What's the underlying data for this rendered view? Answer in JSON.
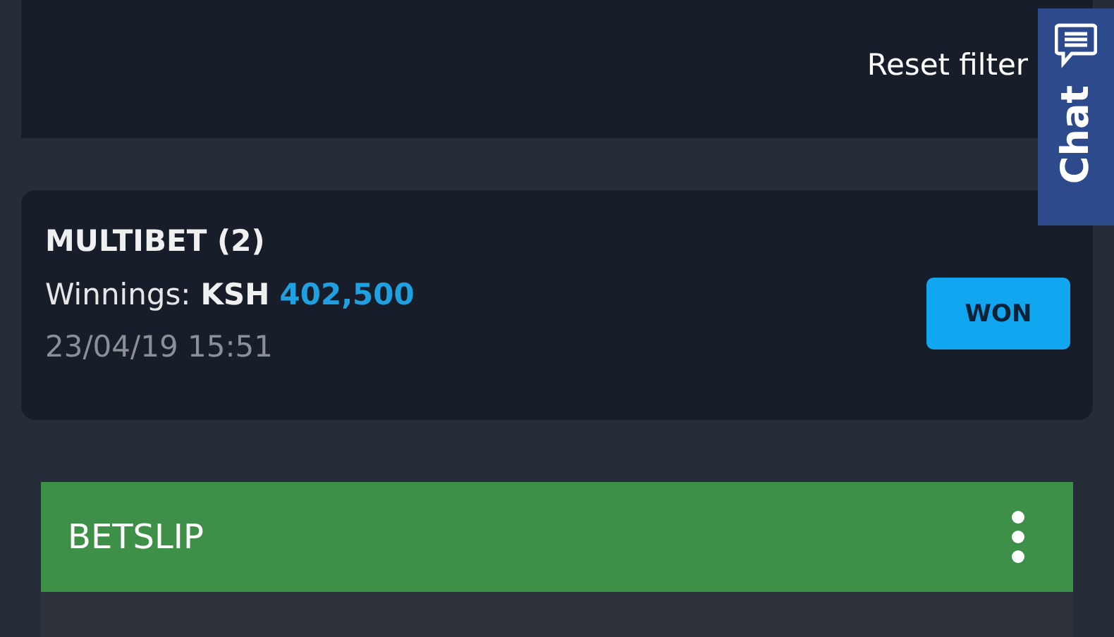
{
  "filters": {
    "reset_link": "Reset filter"
  },
  "chat_tab": {
    "label": "Chat"
  },
  "bet": {
    "title": "MULTIBET (2)",
    "winnings_label": "Winnings:",
    "currency": "KSH",
    "amount": "402,500",
    "date": "23/04/19 15:51",
    "status": "WON"
  },
  "betslip": {
    "title": "BETSLIP"
  }
}
